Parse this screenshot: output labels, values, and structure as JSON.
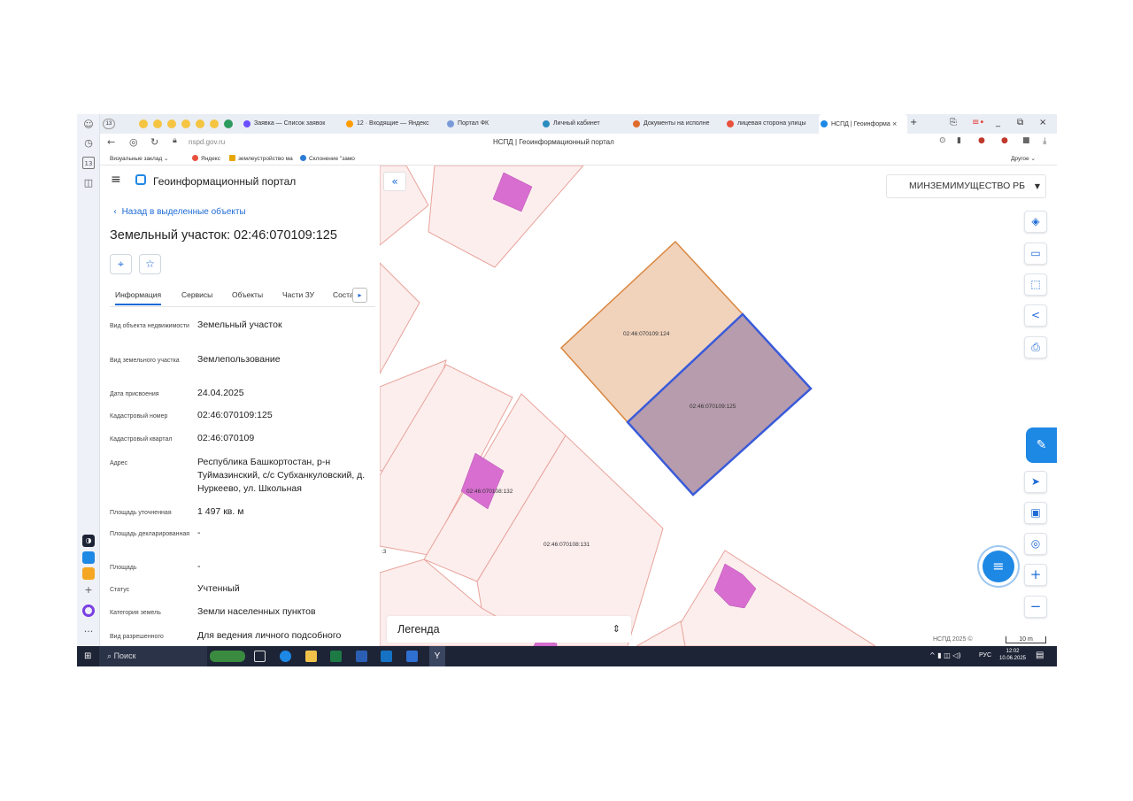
{
  "browser": {
    "tabs": [
      {
        "label": "Заявка — Список заявок",
        "color": "#6b4eff"
      },
      {
        "label": "12 · Входящие — Яндекс",
        "color": "#ff9c00"
      },
      {
        "label": "Портал ФК",
        "color": "#7a9bd8"
      },
      {
        "label": "Личный кабинет",
        "color": "#2b8bbd"
      },
      {
        "label": "Документы на исполне",
        "color": "#e06a2b"
      },
      {
        "label": "лицевая сторона улицы",
        "color": "#e8513c"
      },
      {
        "label": "НСПД | Геоинформа",
        "color": "#1e88e5",
        "active": true
      }
    ],
    "tab_count_badge": "13",
    "url": "nspd.gov.ru",
    "page_title": "НСПД | Геоинформационный портал",
    "bookmarks": [
      {
        "label": "Визуальные заклад",
        "color": "#bbbbbb"
      },
      {
        "label": "Яндекс",
        "color": "#e8513c"
      },
      {
        "label": "землеустройство ма",
        "color": "#e6a700"
      },
      {
        "label": "Склонение \"замо",
        "color": "#2b7bd6"
      }
    ],
    "bookmarks_other": "Другое"
  },
  "panel": {
    "portal_title": "Геоинформационный портал",
    "back_link": "Назад в выделенные объекты",
    "object_title": "Земельный участок: 02:46:070109:125",
    "tabs": [
      "Информация",
      "Сервисы",
      "Объекты",
      "Части ЗУ",
      "Состав"
    ],
    "properties": [
      {
        "label": "Вид объекта недвижимости",
        "value": "Земельный участок"
      },
      {
        "label": "Вид земельного участка",
        "value": "Землепользование"
      },
      {
        "label": "Дата присвоения",
        "value": "24.04.2025"
      },
      {
        "label": "Кадастровый номер",
        "value": "02:46:070109:125"
      },
      {
        "label": "Кадастровый квартал",
        "value": "02:46:070109"
      },
      {
        "label": "Адрес",
        "value": "Республика Башкортостан, р-н Туймазинский, с/с Субханкуловский, д. Нуркеево, ул. Школьная"
      },
      {
        "label": "Площадь уточненная",
        "value": "1 497 кв. м"
      },
      {
        "label": "Площадь декларированная",
        "value": "-"
      },
      {
        "label": "Площадь",
        "value": "-"
      },
      {
        "label": "Статус",
        "value": "Учтенный"
      },
      {
        "label": "Категория земель",
        "value": "Земли населенных пунктов"
      },
      {
        "label": "Вид разрешенного",
        "value": "Для ведения личного подсобного"
      }
    ]
  },
  "map": {
    "layer_select": "МИНЗЕМИМУЩЕСТВО РБ",
    "legend": "Легенда",
    "copyright": "НСПД 2025 ©",
    "scale": "10 m",
    "parcels": [
      {
        "id": "02:46:070109:124"
      },
      {
        "id": "02:46:070109:125"
      },
      {
        "id": "02:46:070108:132"
      },
      {
        "id": "02:46:070108:131"
      }
    ],
    "edge_label": ":3",
    "colors": {
      "parcel_fill": "#fdeeee",
      "parcel_stroke": "#e8a39a",
      "selected_fill": "#b79cad",
      "selected_stroke": "#3a5bd9",
      "neighbor_fill": "#f1d3bc",
      "neighbor_stroke": "#d9863f",
      "building": "#d86fd0"
    }
  },
  "taskbar": {
    "search": "Поиск",
    "lang": "РУС",
    "time": "12:02",
    "date": "10.06.2025"
  }
}
